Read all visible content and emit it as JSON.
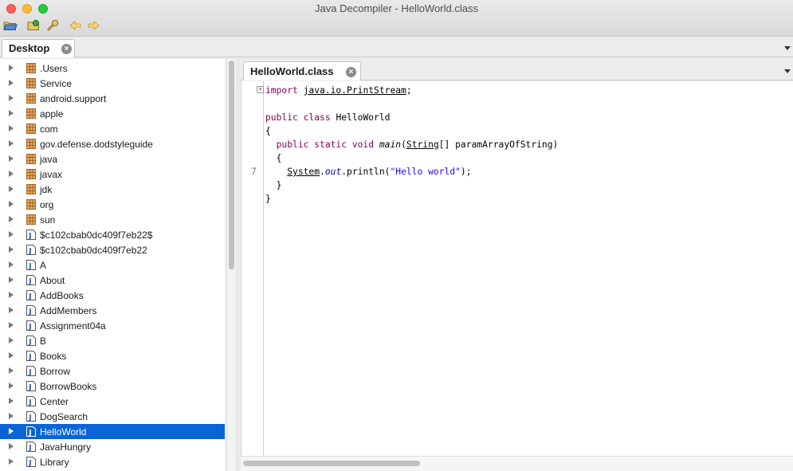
{
  "window": {
    "title": "Java Decompiler - HelloWorld.class"
  },
  "toolbar": {
    "buttons": [
      "open-folder-icon",
      "open-jar-icon",
      "search-type-icon",
      "back-icon",
      "forward-icon"
    ]
  },
  "desktop_tab": {
    "label": "Desktop"
  },
  "editor_tab": {
    "label": "HelloWorld.class"
  },
  "tree": {
    "items": [
      {
        "label": ".Users",
        "type": "package"
      },
      {
        "label": "Service",
        "type": "package"
      },
      {
        "label": "android.support",
        "type": "package"
      },
      {
        "label": "apple",
        "type": "package"
      },
      {
        "label": "com",
        "type": "package"
      },
      {
        "label": "gov.defense.dodstyleguide",
        "type": "package"
      },
      {
        "label": "java",
        "type": "package"
      },
      {
        "label": "javax",
        "type": "package"
      },
      {
        "label": "jdk",
        "type": "package"
      },
      {
        "label": "org",
        "type": "package"
      },
      {
        "label": "sun",
        "type": "package"
      },
      {
        "label": "$c102cbab0dc409f7eb22$",
        "type": "class"
      },
      {
        "label": "$c102cbab0dc409f7eb22",
        "type": "class"
      },
      {
        "label": "A",
        "type": "class"
      },
      {
        "label": "About",
        "type": "class"
      },
      {
        "label": "AddBooks",
        "type": "class"
      },
      {
        "label": "AddMembers",
        "type": "class"
      },
      {
        "label": "Assignment04a",
        "type": "class"
      },
      {
        "label": "B",
        "type": "class"
      },
      {
        "label": "Books",
        "type": "class"
      },
      {
        "label": "Borrow",
        "type": "class"
      },
      {
        "label": "BorrowBooks",
        "type": "class"
      },
      {
        "label": "Center",
        "type": "class"
      },
      {
        "label": "DogSearch",
        "type": "class"
      },
      {
        "label": "HelloWorld",
        "type": "class",
        "selected": true
      },
      {
        "label": "JavaHungry",
        "type": "class"
      },
      {
        "label": "Library",
        "type": "class"
      }
    ]
  },
  "code": {
    "import_kw": "import",
    "import_path": "java.io.PrintStream",
    "import_semicolon": ";",
    "class_mods": "public class",
    "class_name": "HelloWorld",
    "open_brace": "{",
    "method_mods": "public static void",
    "method_name": "main",
    "method_open": "(",
    "param_type": "String",
    "param_rest": "[] paramArrayOfString)",
    "method_open_brace": "{",
    "sys": "System",
    "dot1": ".",
    "out": "out",
    "println": ".println(",
    "str": "\"Hello world\"",
    "end": ");",
    "method_close_brace": "}",
    "class_close_brace": "}",
    "line_number": "7"
  },
  "colors": {
    "selection": "#0a64d8",
    "keyword": "#7f0055",
    "string": "#2a00ff",
    "field": "#0000c0"
  }
}
